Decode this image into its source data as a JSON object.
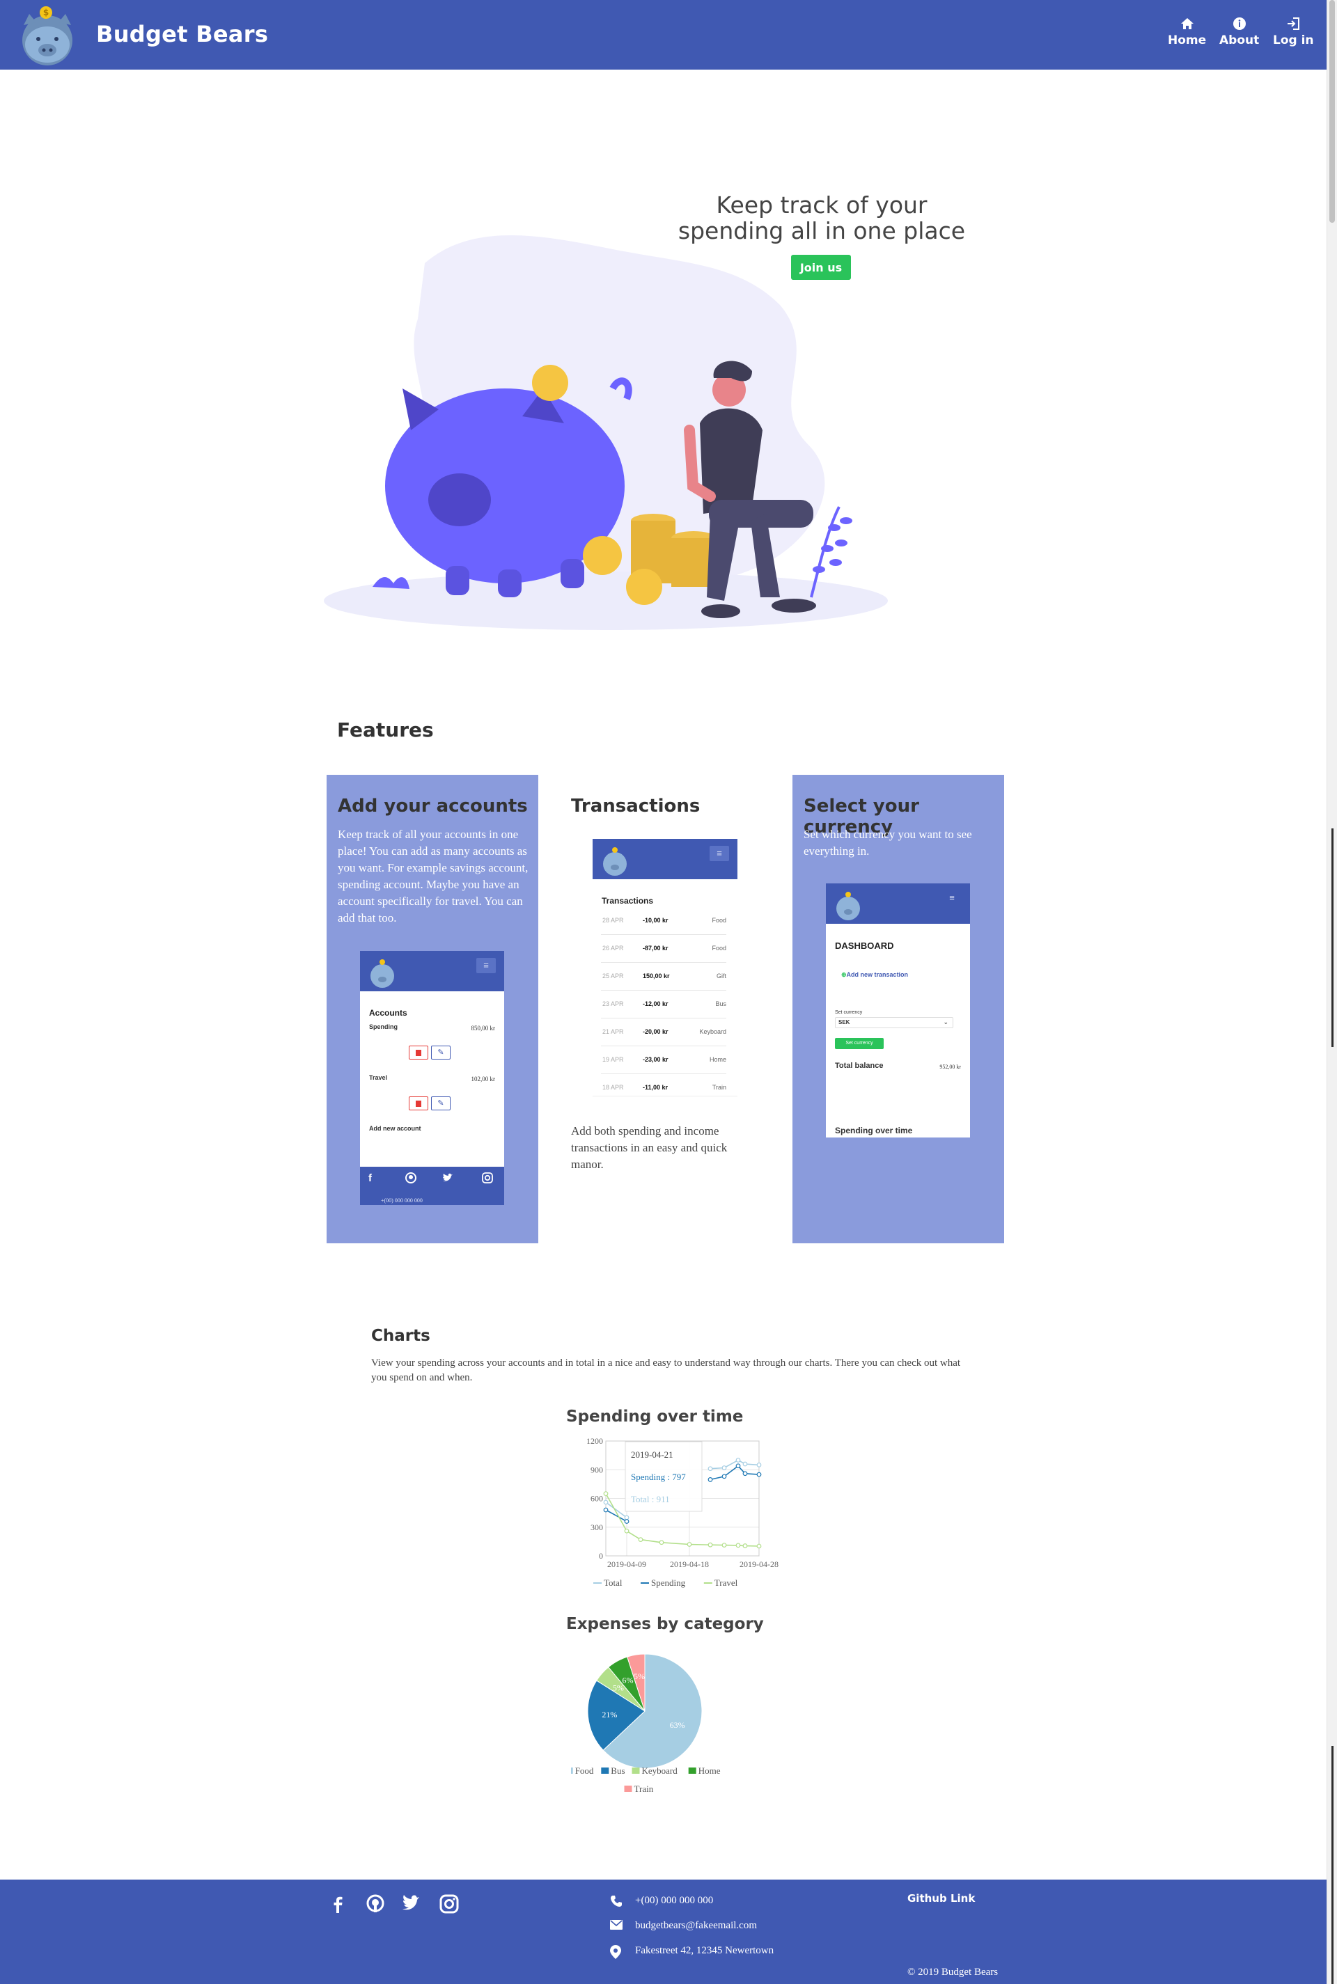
{
  "header": {
    "brand": "Budget Bears",
    "nav": [
      {
        "label": "Home",
        "icon": "home-icon"
      },
      {
        "label": "About",
        "icon": "info-icon"
      },
      {
        "label": "Log in",
        "icon": "login-icon"
      }
    ]
  },
  "hero": {
    "title_line1": "Keep track of your",
    "title_line2": "spending all in one place",
    "cta": "Join us"
  },
  "features": {
    "heading": "Features",
    "cards": [
      {
        "title": "Add your accounts",
        "text": "Keep track of all your accounts in one place! You can add as many accounts as you want. For example savings account, spending account. Maybe you have an account specifically for travel. You can add that too.",
        "phone": {
          "heading": "Accounts",
          "accounts": [
            {
              "name": "Spending",
              "amount": "850,00 kr"
            },
            {
              "name": "Travel",
              "amount": "102,00 kr"
            }
          ],
          "add_label": "Add new account",
          "phone_number": "+(00) 000 000 000"
        }
      },
      {
        "title": "Transactions",
        "text": "Add both spending and income transactions in an easy and quick manor.",
        "phone": {
          "heading": "Transactions",
          "rows": [
            {
              "date": "28 APR",
              "amount": "-10,00 kr",
              "category": "Food"
            },
            {
              "date": "26 APR",
              "amount": "-87,00 kr",
              "category": "Food"
            },
            {
              "date": "25 APR",
              "amount": "150,00 kr",
              "category": "Gift"
            },
            {
              "date": "23 APR",
              "amount": "-12,00 kr",
              "category": "Bus"
            },
            {
              "date": "21 APR",
              "amount": "-20,00 kr",
              "category": "Keyboard"
            },
            {
              "date": "19 APR",
              "amount": "-23,00 kr",
              "category": "Home"
            },
            {
              "date": "18 APR",
              "amount": "-11,00 kr",
              "category": "Train"
            }
          ]
        }
      },
      {
        "title": "Select your currency",
        "text": "Set which currency you want to see everything in.",
        "phone": {
          "heading": "DASHBOARD",
          "add_transaction": "Add new transaction",
          "currency_label": "Set currency",
          "currency_value": "SEK",
          "currency_button": "Set currency",
          "balance_label": "Total balance",
          "balance_value": "952,00 kr",
          "spending_label": "Spending over time"
        }
      }
    ]
  },
  "charts": {
    "heading": "Charts",
    "text": "View your spending across your accounts and in total in a nice and easy to understand way through our charts. There you can check out what you spend on and when.",
    "line_title": "Spending over time",
    "pie_title": "Expenses by category",
    "tooltip": {
      "date": "2019-04-21",
      "spending": "Spending : 797",
      "total": "Total : 911"
    }
  },
  "chart_data": [
    {
      "type": "line",
      "title": "Spending over time",
      "x": [
        "2019-04-06",
        "2019-04-09",
        "2019-04-11",
        "2019-04-14",
        "2019-04-18",
        "2019-04-21",
        "2019-04-23",
        "2019-04-25",
        "2019-04-26",
        "2019-04-28"
      ],
      "x_ticks": [
        "2019-04-09",
        "2019-04-18",
        "2019-04-28"
      ],
      "y_ticks": [
        0,
        300,
        600,
        900,
        1200
      ],
      "ylim": [
        0,
        1200
      ],
      "series": [
        {
          "name": "Total",
          "color": "#a6cee3",
          "values": [
            560,
            400,
            null,
            null,
            null,
            911,
            920,
            1000,
            960,
            950
          ]
        },
        {
          "name": "Spending",
          "color": "#1f78b4",
          "values": [
            480,
            360,
            null,
            null,
            null,
            797,
            830,
            940,
            860,
            850
          ]
        },
        {
          "name": "Travel",
          "color": "#b2df8a",
          "values": [
            650,
            260,
            170,
            140,
            120,
            115,
            112,
            110,
            105,
            102
          ]
        }
      ]
    },
    {
      "type": "pie",
      "title": "Expenses by category",
      "categories": [
        "Food",
        "Bus",
        "Keyboard",
        "Home",
        "Train"
      ],
      "values": [
        63,
        21,
        5,
        6,
        5
      ],
      "labels": [
        "63%",
        "21%",
        "5%",
        "6%",
        "5%"
      ],
      "colors": [
        "#a6cee3",
        "#1f78b4",
        "#b2df8a",
        "#33a02c",
        "#fb9a99"
      ]
    }
  ],
  "footer": {
    "phone": "+(00) 000 000 000",
    "email": "budgetbears@fakeemail.com",
    "address": "Fakestreet 42, 12345 Newertown",
    "github": "Github Link",
    "copyright": "© 2019 Budget Bears"
  }
}
